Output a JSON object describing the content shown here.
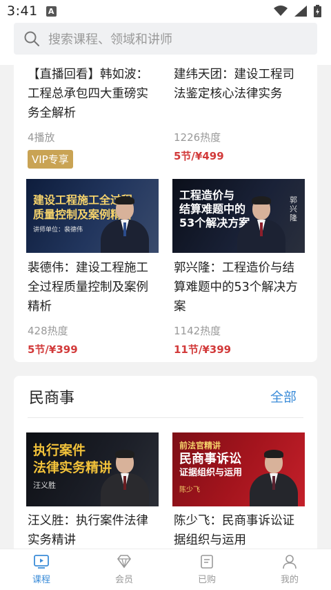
{
  "status_bar": {
    "time": "3:41",
    "indicator": "A",
    "icons": [
      "wifi-icon",
      "signal-icon",
      "battery-icon"
    ]
  },
  "search": {
    "placeholder": "搜索课程、领域和讲师"
  },
  "courses_top": [
    {
      "title": "【直播回看】韩如波：工程总承包四大重磅实务全解析",
      "meta": "4播放",
      "badge": "VIP专享"
    },
    {
      "title": "建纬天团：建设工程司法鉴定核心法律实务",
      "meta": "1226热度",
      "price": "5节/¥499"
    },
    {
      "title": "裴德伟：建设工程施工全过程质量控制及案例精析",
      "meta": "428热度",
      "price": "5节/¥399",
      "thumb": {
        "lines": [
          "建设工程施工全过程",
          "质量控制及案例精析"
        ],
        "caption": "讲师单位：裴德伟"
      }
    },
    {
      "title": "郭兴隆：工程造价与结算难题中的53个解决方案",
      "meta": "1142热度",
      "price": "11节/¥399",
      "thumb": {
        "lines": [
          "工程造价与",
          "结算难题中的",
          "53个解决方案"
        ],
        "caption": "郭兴隆"
      }
    }
  ],
  "section_civil": {
    "title": "民商事",
    "all_label": "全部",
    "courses": [
      {
        "title": "汪义胜：执行案件法律实务精讲",
        "thumb": {
          "lines": [
            "执行案件",
            "法律实务精讲"
          ],
          "caption": "汪义胜"
        }
      },
      {
        "title": "陈少飞：民商事诉讼证据组织与运用",
        "thumb": {
          "lines": [
            "前法官精讲",
            "民商事诉讼",
            "证据组织与运用"
          ],
          "caption": "陈少飞"
        }
      }
    ]
  },
  "bottom_nav": [
    {
      "label": "课程",
      "icon": "course-icon",
      "active": true
    },
    {
      "label": "会员",
      "icon": "diamond-icon",
      "active": false
    },
    {
      "label": "已购",
      "icon": "purchased-icon",
      "active": false
    },
    {
      "label": "我的",
      "icon": "profile-icon",
      "active": false
    }
  ],
  "colors": {
    "accent": "#3b8cd8",
    "price": "#d23a3a",
    "vip": "#c9a354"
  }
}
